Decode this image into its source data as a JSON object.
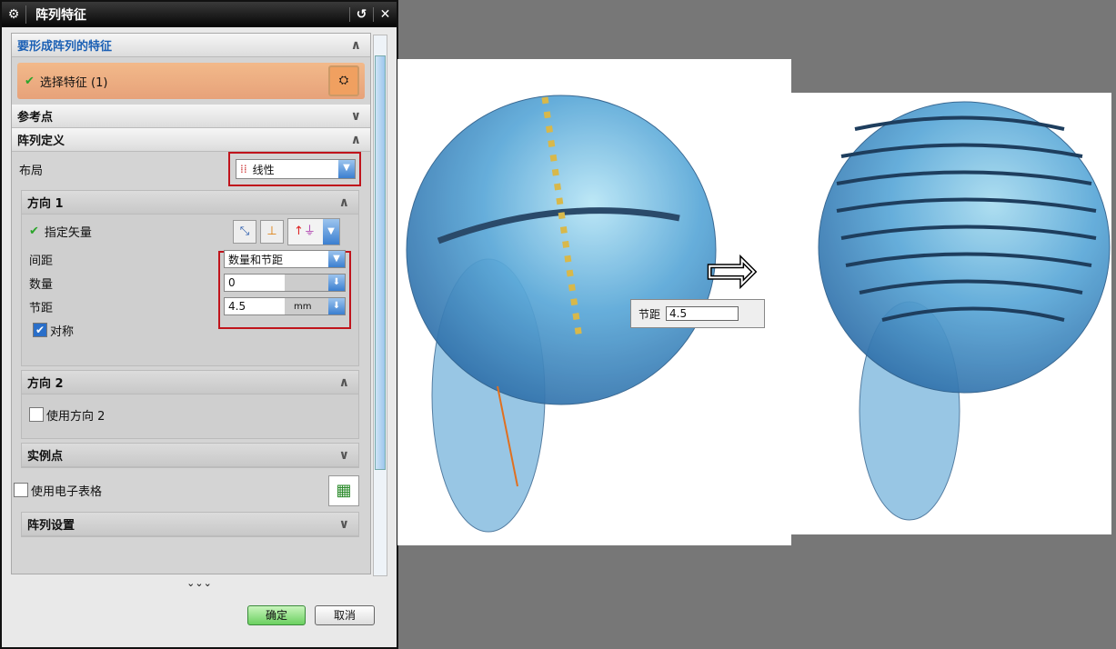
{
  "dialog": {
    "title": "阵列特征"
  },
  "sections": {
    "features": {
      "label": "要形成阵列的特征",
      "select": "选择特征 (1)"
    },
    "ref_point": {
      "label": "参考点"
    },
    "definition": {
      "label": "阵列定义",
      "layout_label": "布局",
      "layout_value": "线性"
    },
    "dir1": {
      "label": "方向 1",
      "vector": "指定矢量",
      "spacing_label": "间距",
      "spacing_value": "数量和节距",
      "count_label": "数量",
      "count_value": "0",
      "pitch_label": "节距",
      "pitch_value": "4.5",
      "pitch_unit": "mm",
      "symmetric": "对称"
    },
    "dir2": {
      "label": "方向 2",
      "use": "使用方向 2"
    },
    "instance": {
      "label": "实例点"
    },
    "spreadsheet": {
      "label": "使用电子表格"
    },
    "settings": {
      "label": "阵列设置"
    }
  },
  "buttons": {
    "ok": "确定",
    "cancel": "取消"
  },
  "viewport": {
    "pitch_label": "节距",
    "pitch_value": "4.5"
  }
}
